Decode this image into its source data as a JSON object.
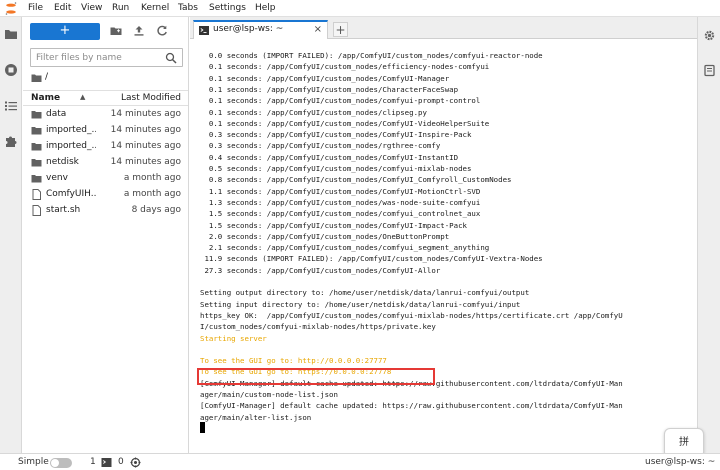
{
  "menubar": {
    "items": [
      "File",
      "Edit",
      "View",
      "Run",
      "Kernel",
      "Tabs",
      "Settings",
      "Help"
    ]
  },
  "filebrowser": {
    "new_button": "+",
    "filter_placeholder": "Filter files by name",
    "breadcrumb": "/",
    "col_name": "Name",
    "col_sort_icon": "▲",
    "col_modified": "Last Modified",
    "files": [
      {
        "name": "data",
        "modified": "14 minutes ago",
        "icon": "folder-icon"
      },
      {
        "name": "imported_...",
        "modified": "14 minutes ago",
        "icon": "folder-icon"
      },
      {
        "name": "imported_...",
        "modified": "14 minutes ago",
        "icon": "folder-icon"
      },
      {
        "name": "netdisk",
        "modified": "14 minutes ago",
        "icon": "folder-icon"
      },
      {
        "name": "venv",
        "modified": "a month ago",
        "icon": "folder-icon"
      },
      {
        "name": "ComfyUIH...",
        "modified": "a month ago",
        "icon": "file-icon"
      },
      {
        "name": "start.sh",
        "modified": "8 days ago",
        "icon": "file-icon"
      }
    ]
  },
  "tabs": [
    {
      "label": "user@lsp-ws: ~",
      "close": "×"
    }
  ],
  "add_tab": "+",
  "terminal": {
    "lines": [
      {
        "text": "  0.0 seconds (IMPORT FAILED): /app/ComfyUI/custom_nodes/comfyui-reactor-node",
        "color": "#1a1a1a"
      },
      {
        "text": "  0.1 seconds: /app/ComfyUI/custom_nodes/efficiency-nodes-comfyui",
        "color": "#1a1a1a"
      },
      {
        "text": "  0.1 seconds: /app/ComfyUI/custom_nodes/ComfyUI-Manager",
        "color": "#1a1a1a"
      },
      {
        "text": "  0.1 seconds: /app/ComfyUI/custom_nodes/CharacterFaceSwap",
        "color": "#1a1a1a"
      },
      {
        "text": "  0.1 seconds: /app/ComfyUI/custom_nodes/comfyui-prompt-control",
        "color": "#1a1a1a"
      },
      {
        "text": "  0.1 seconds: /app/ComfyUI/custom_nodes/clipseg.py",
        "color": "#1a1a1a"
      },
      {
        "text": "  0.1 seconds: /app/ComfyUI/custom_nodes/ComfyUI-VideoHelperSuite",
        "color": "#1a1a1a"
      },
      {
        "text": "  0.3 seconds: /app/ComfyUI/custom_nodes/ComfyUI-Inspire-Pack",
        "color": "#1a1a1a"
      },
      {
        "text": "  0.3 seconds: /app/ComfyUI/custom_nodes/rgthree-comfy",
        "color": "#1a1a1a"
      },
      {
        "text": "  0.4 seconds: /app/ComfyUI/custom_nodes/ComfyUI-InstantID",
        "color": "#1a1a1a"
      },
      {
        "text": "  0.5 seconds: /app/ComfyUI/custom_nodes/comfyui-mixlab-nodes",
        "color": "#1a1a1a"
      },
      {
        "text": "  0.8 seconds: /app/ComfyUI/custom_nodes/ComfyUI_Comfyroll_CustomNodes",
        "color": "#1a1a1a"
      },
      {
        "text": "  1.1 seconds: /app/ComfyUI/custom_nodes/ComfyUI-MotionCtrl-SVD",
        "color": "#1a1a1a"
      },
      {
        "text": "  1.3 seconds: /app/ComfyUI/custom_nodes/was-node-suite-comfyui",
        "color": "#1a1a1a"
      },
      {
        "text": "  1.5 seconds: /app/ComfyUI/custom_nodes/comfyui_controlnet_aux",
        "color": "#1a1a1a"
      },
      {
        "text": "  1.5 seconds: /app/ComfyUI/custom_nodes/ComfyUI-Impact-Pack",
        "color": "#1a1a1a"
      },
      {
        "text": "  2.0 seconds: /app/ComfyUI/custom_nodes/OneButtonPrompt",
        "color": "#1a1a1a"
      },
      {
        "text": "  2.1 seconds: /app/ComfyUI/custom_nodes/comfyui_segment_anything",
        "color": "#1a1a1a"
      },
      {
        "text": " 11.9 seconds (IMPORT FAILED): /app/ComfyUI/custom_nodes/ComfyUI-Vextra-Nodes",
        "color": "#1a1a1a"
      },
      {
        "text": " 27.3 seconds: /app/ComfyUI/custom_nodes/ComfyUI-Allor",
        "color": "#1a1a1a"
      },
      {
        "text": "",
        "color": "#1a1a1a"
      },
      {
        "text": "Setting output directory to: /home/user/netdisk/data/lanrui-comfyui/output",
        "color": "#1a1a1a"
      },
      {
        "text": "Setting input directory to: /home/user/netdisk/data/lanrui-comfyui/input",
        "color": "#1a1a1a"
      },
      {
        "text": "https_key OK:  /app/ComfyUI/custom_nodes/comfyui-mixlab-nodes/https/certificate.crt /app/ComfyU",
        "color": "#1a1a1a"
      },
      {
        "text": "I/custom_nodes/comfyui-mixlab-nodes/https/private.key",
        "color": "#1a1a1a"
      },
      {
        "text": "Starting server",
        "color": "#e8a600"
      },
      {
        "text": "",
        "color": "#1a1a1a"
      },
      {
        "text": "To see the GUI go to: http://0.0.0.0:27777",
        "color": "#e8a600"
      },
      {
        "text": "To see the GUI go to: https://0.0.0.0:27778",
        "color": "#e8a600"
      },
      {
        "text": "[ComfyUI-Manager] default cache updated: https://raw.githubusercontent.com/ltdrdata/ComfyUI-Man",
        "color": "#1a1a1a"
      },
      {
        "text": "ager/main/custom-node-list.json",
        "color": "#1a1a1a"
      },
      {
        "text": "[ComfyUI-Manager] default cache updated: https://raw.githubusercontent.com/ltdrdata/ComfyUI-Man",
        "color": "#1a1a1a"
      },
      {
        "text": "ager/main/alter-list.json",
        "color": "#1a1a1a"
      }
    ]
  },
  "keyboard_button": "拼",
  "statusbar": {
    "mode_label": "Simple",
    "terminals_count": "1",
    "kernels_count": "0",
    "user_host": "user@lsp-ws: ~"
  },
  "colors": {
    "accent": "#1976d2",
    "highlight_box": "#e53935",
    "terminal_warning": "#e8a600"
  }
}
